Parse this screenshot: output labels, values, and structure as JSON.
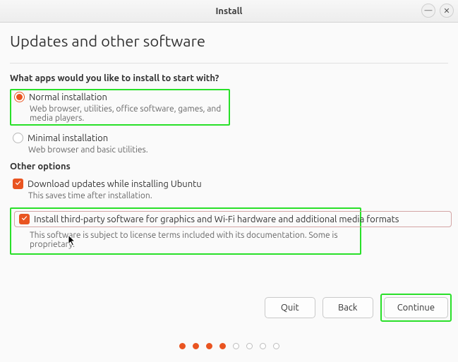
{
  "window": {
    "title": "Install"
  },
  "page": {
    "heading": "Updates and other software"
  },
  "apps_section": {
    "label": "What apps would you like to install to start with?",
    "normal": {
      "label": "Normal installation",
      "desc": "Web browser, utilities, office software, games, and media players."
    },
    "minimal": {
      "label": "Minimal installation",
      "desc": "Web browser and basic utilities."
    }
  },
  "other_section": {
    "label": "Other options",
    "updates": {
      "label": "Download updates while installing Ubuntu",
      "desc": "This saves time after installation."
    },
    "thirdparty": {
      "label": "Install third-party software for graphics and Wi-Fi hardware and additional media formats",
      "desc": "This software is subject to license terms included with its documentation. Some is proprietary."
    }
  },
  "buttons": {
    "quit": "Quit",
    "back": "Back",
    "continue": "Continue"
  },
  "pager": {
    "total": 8,
    "current": 4
  }
}
